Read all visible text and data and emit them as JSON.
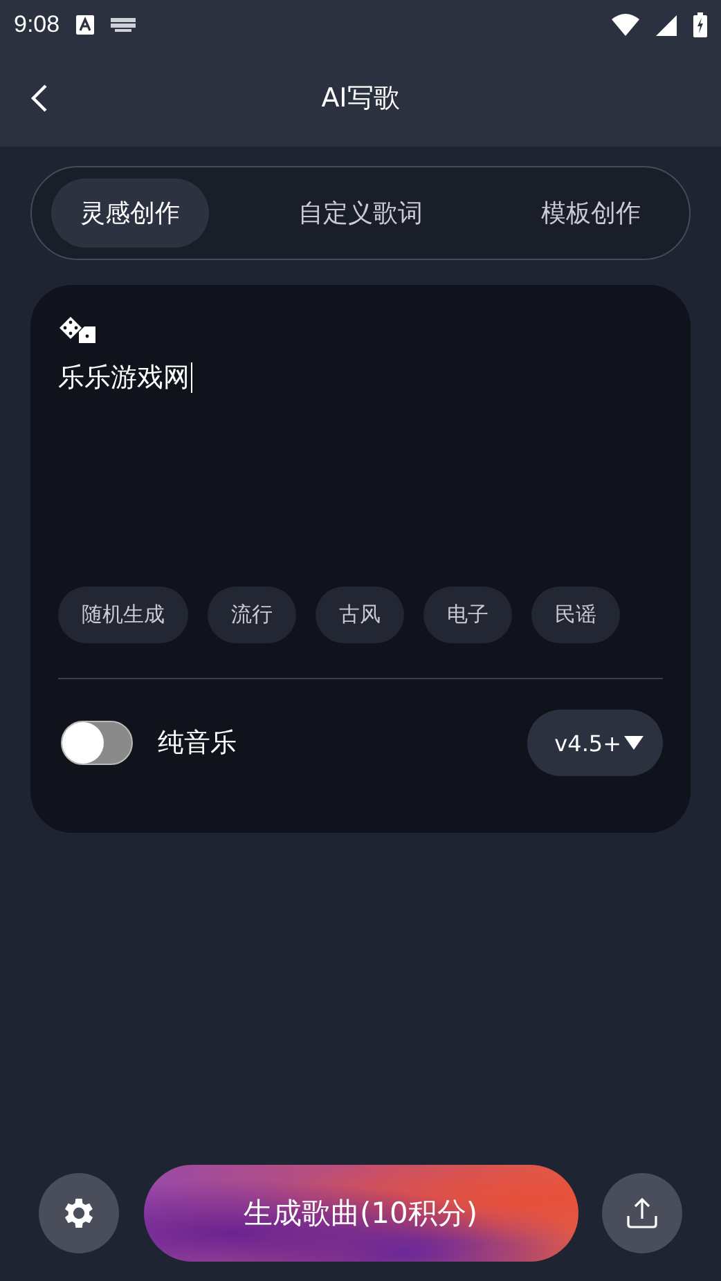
{
  "status_bar": {
    "time": "9:08"
  },
  "header": {
    "title": "AI写歌"
  },
  "tabs": [
    {
      "label": "灵感创作",
      "selected": true
    },
    {
      "label": "自定义歌词",
      "selected": false
    },
    {
      "label": "模板创作",
      "selected": false
    }
  ],
  "prompt": {
    "value": "乐乐游戏网"
  },
  "styles": [
    {
      "label": "随机生成"
    },
    {
      "label": "流行"
    },
    {
      "label": "古风"
    },
    {
      "label": "电子"
    },
    {
      "label": "民谣"
    }
  ],
  "instrumental": {
    "label": "纯音乐",
    "on": false
  },
  "version": {
    "label": "v4.5+"
  },
  "generate_button": {
    "label": "生成歌曲(10积分)"
  }
}
